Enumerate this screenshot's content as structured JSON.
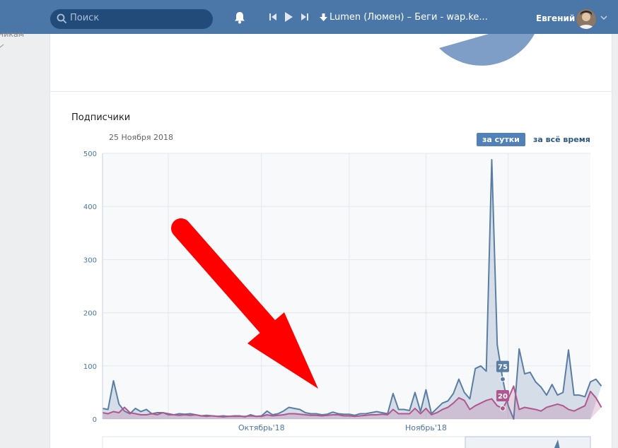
{
  "topbar": {
    "search_placeholder": "Поиск",
    "track_title": "Lumen (Люмен) – Беги - wap.ke...",
    "user_name": "Евгений"
  },
  "sidebar": {
    "partial_item": "никам"
  },
  "section": {
    "title": "Подписчики",
    "date": "25 Ноября 2018",
    "btn_day": "за сутки",
    "btn_all": "за всё время"
  },
  "colors": {
    "topbar": "#4a76a8",
    "series_total": "#5a7ea3",
    "series_new": "#b0578f",
    "arrow": "#ff0000"
  },
  "chart_data": {
    "type": "area",
    "x": [
      1,
      2,
      3,
      4,
      5,
      6,
      7,
      8,
      9,
      10,
      11,
      12,
      13,
      14,
      15,
      16,
      17,
      18,
      19,
      20,
      21,
      22,
      23,
      24,
      25,
      26,
      27,
      28,
      29,
      30,
      31,
      32,
      33,
      34,
      35,
      36,
      37,
      38,
      39,
      40,
      41,
      42,
      43,
      44,
      45,
      46,
      47,
      48,
      49,
      50,
      51,
      52,
      53,
      54,
      55,
      56,
      57,
      58,
      59,
      60,
      61,
      62,
      63,
      64,
      65,
      66,
      67,
      68,
      69,
      70,
      71,
      72,
      73,
      74,
      75,
      76,
      77,
      78,
      79,
      80,
      81,
      82,
      83,
      84,
      85,
      86,
      87,
      88,
      89,
      90
    ],
    "x_ticks": [
      {
        "index": 29,
        "label": "Октябрь'18"
      },
      {
        "index": 59,
        "label": "Ноябрь'18"
      }
    ],
    "ylim": [
      0,
      500
    ],
    "yticks": [
      0,
      100,
      200,
      300,
      400,
      500
    ],
    "grid": true,
    "series": [
      {
        "values": [
          20,
          18,
          72,
          28,
          15,
          10,
          20,
          14,
          18,
          10,
          12,
          12,
          8,
          8,
          10,
          9,
          10,
          8,
          6,
          7,
          6,
          5,
          6,
          5,
          6,
          6,
          4,
          8,
          5,
          6,
          15,
          8,
          10,
          15,
          22,
          20,
          18,
          12,
          10,
          10,
          8,
          9,
          13,
          10,
          9,
          9,
          7,
          10,
          10,
          12,
          14,
          12,
          10,
          48,
          18,
          18,
          16,
          50,
          14,
          55,
          10,
          20,
          30,
          34,
          48,
          75,
          50,
          38,
          95,
          100,
          90,
          488,
          140,
          75,
          25,
          0,
          132,
          85,
          88,
          70,
          60,
          45,
          65,
          45,
          50,
          130,
          45,
          45,
          42,
          70,
          75,
          62
        ]
      },
      {
        "values": [
          12,
          10,
          14,
          12,
          22,
          12,
          10,
          8,
          8,
          10,
          8,
          12,
          10,
          8,
          7,
          8,
          7,
          8,
          6,
          5,
          6,
          5,
          4,
          5,
          5,
          5,
          5,
          6,
          5,
          5,
          8,
          6,
          7,
          8,
          10,
          10,
          9,
          8,
          7,
          7,
          6,
          7,
          8,
          8,
          6,
          6,
          5,
          6,
          7,
          8,
          8,
          9,
          8,
          18,
          10,
          10,
          10,
          20,
          10,
          20,
          8,
          12,
          18,
          22,
          30,
          40,
          35,
          18,
          25,
          30,
          35,
          38,
          25,
          20,
          38,
          62,
          18,
          22,
          20,
          18,
          15,
          22,
          25,
          28,
          25,
          18,
          15,
          20,
          25,
          52,
          40,
          22
        ]
      }
    ],
    "annotations": [
      {
        "index": 73,
        "series": 0,
        "label": "75"
      },
      {
        "index": 73,
        "series": 1,
        "label": "20"
      }
    ]
  }
}
